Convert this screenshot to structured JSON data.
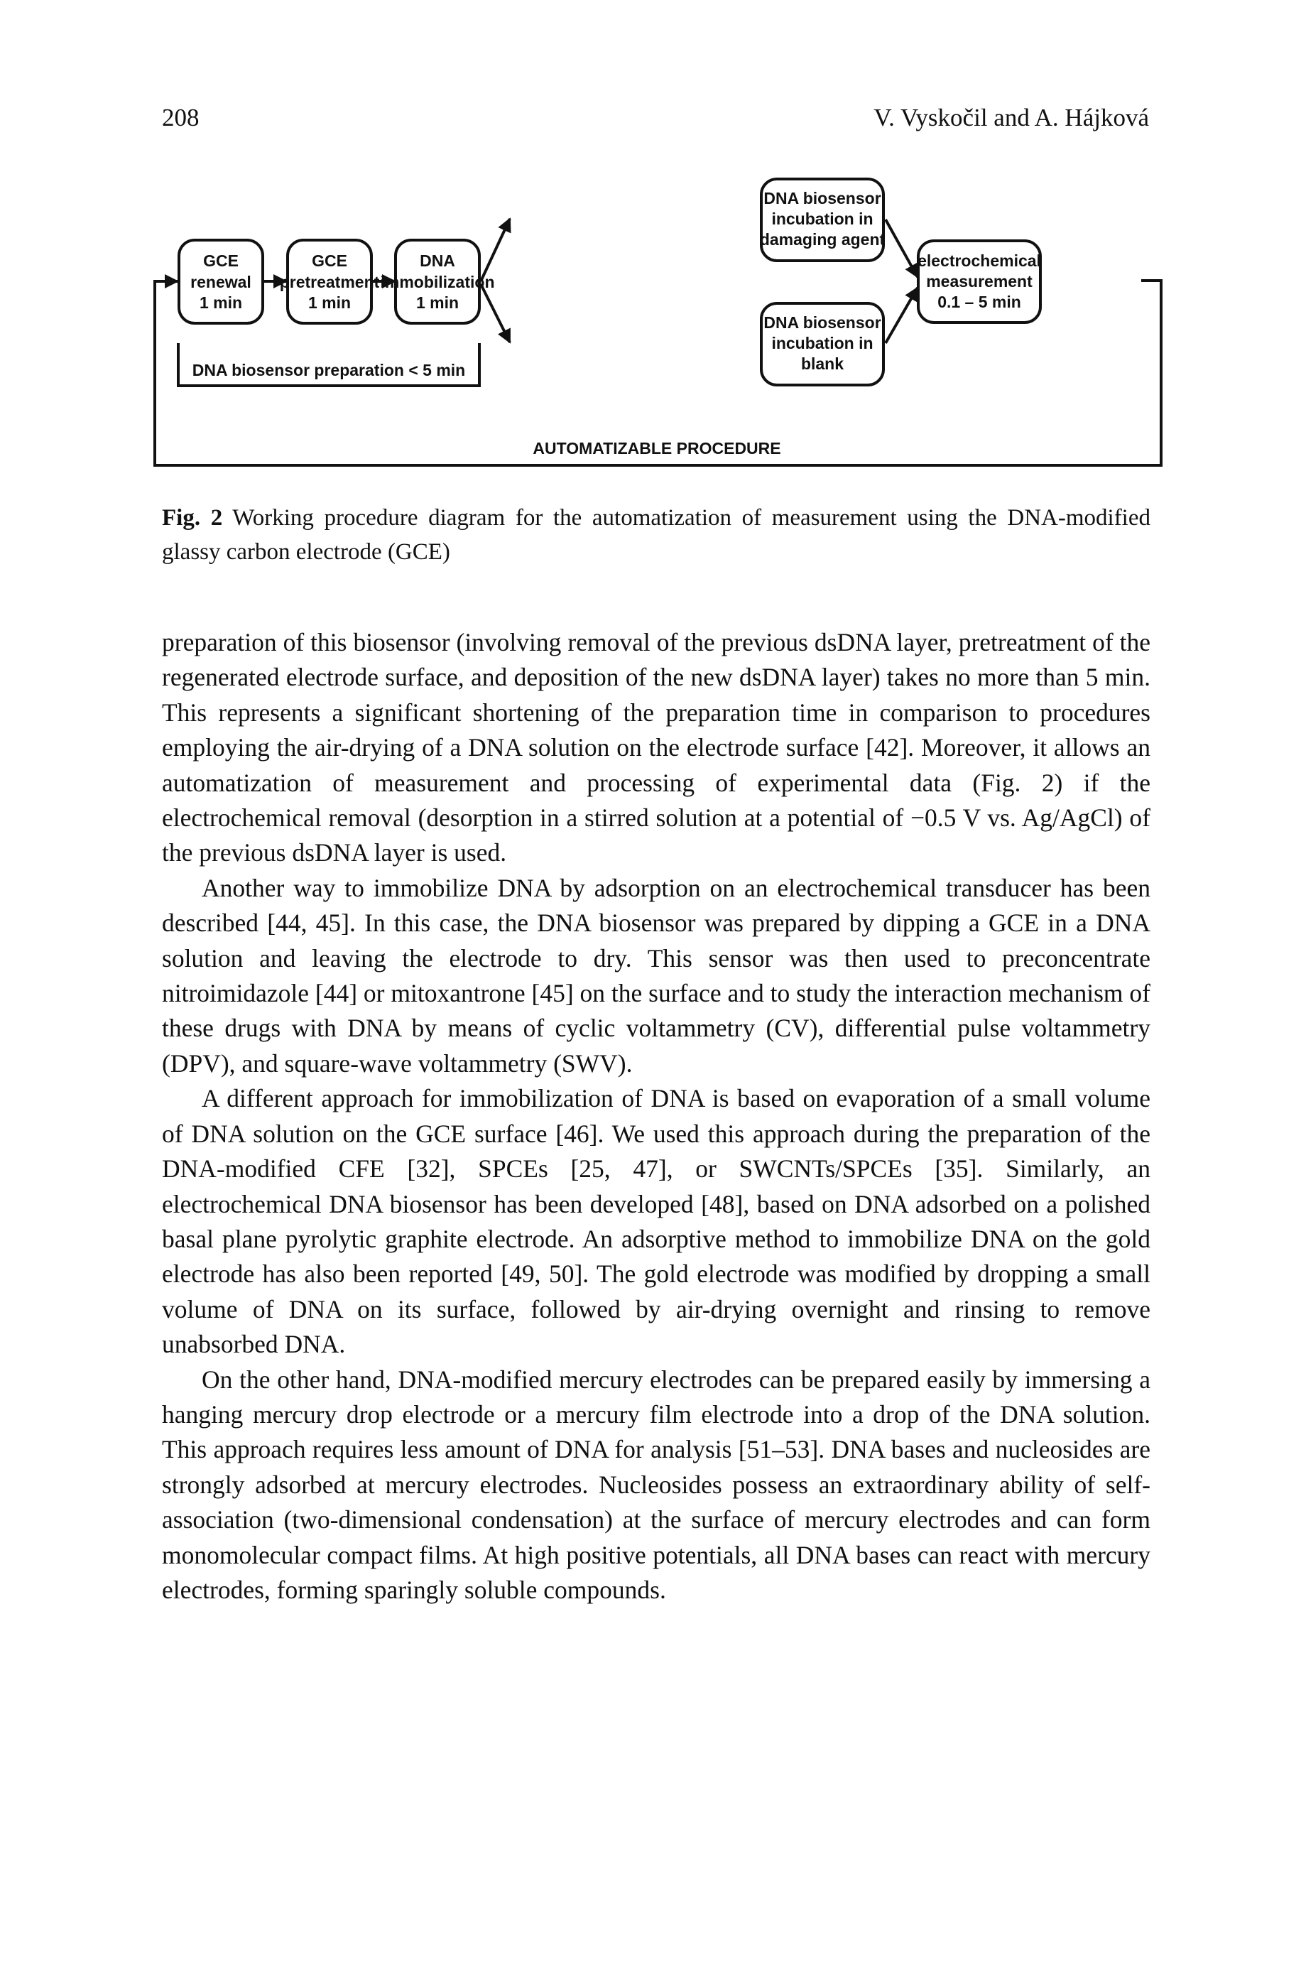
{
  "header": {
    "page_number": "208",
    "running_head": "V. Vyskočil and A. Hájková"
  },
  "figure": {
    "boxes": {
      "gce_renewal": [
        "GCE",
        "renewal",
        "1 min"
      ],
      "gce_pretreatment": [
        "GCE",
        "pretreatment",
        "1 min"
      ],
      "dna_immobilization": [
        "DNA",
        "immobilization",
        "1 min"
      ],
      "incubation_damaging": [
        "DNA biosensor",
        "incubation in",
        "damaging agent"
      ],
      "incubation_blank": [
        "DNA biosensor",
        "incubation in",
        "blank"
      ],
      "electrochemical_measurement": [
        "electrochemical",
        "measurement",
        "0.1 – 5 min"
      ]
    },
    "preparation_label": "DNA biosensor preparation < 5 min",
    "procedure_label": "AUTOMATIZABLE PROCEDURE"
  },
  "caption": {
    "label": "Fig. 2",
    "text": " Working procedure diagram for the automatization of measurement using the DNA-modified glassy carbon electrode (GCE)"
  },
  "paragraphs": [
    "preparation of this biosensor (involving removal of the previous dsDNA layer, pretreatment of the regenerated electrode surface, and deposition of the new dsDNA layer) takes no more than 5 min. This represents a significant shortening of the preparation time in comparison to procedures employing the air-drying of a DNA solution on the electrode surface [42]. Moreover, it allows an automatization of measurement and processing of experimental data (Fig. 2) if the electrochemical removal (desorption in a stirred solution at a potential of −0.5 V vs. Ag/AgCl) of the previous dsDNA layer is used.",
    "Another way to immobilize DNA by adsorption on an electrochemical transducer has been described [44, 45]. In this case, the DNA biosensor was prepared by dipping a GCE in a DNA solution and leaving the electrode to dry. This sensor was then used to preconcentrate nitroimidazole [44] or mitoxantrone [45] on the surface and to study the interaction mechanism of these drugs with DNA by means of cyclic voltammetry (CV), differential pulse voltammetry (DPV), and square-wave voltammetry (SWV).",
    "A different approach for immobilization of DNA is based on evaporation of a small volume of DNA solution on the GCE surface [46]. We used this approach during the preparation of the DNA-modified CFE [32], SPCEs [25, 47], or SWCNTs/SPCEs [35]. Similarly, an electrochemical DNA biosensor has been developed [48], based on DNA adsorbed on a polished basal plane pyrolytic graphite electrode. An adsorptive method to immobilize DNA on the gold electrode has also been reported [49, 50]. The gold electrode was modified by dropping a small volume of DNA on its surface, followed by air-drying overnight and rinsing to remove unabsorbed DNA.",
    "On the other hand, DNA-modified mercury electrodes can be prepared easily by immersing a hanging mercury drop electrode or a mercury film electrode into a drop of the DNA solution. This approach requires less amount of DNA for analysis [51–53]. DNA bases and nucleosides are strongly adsorbed at mercury electrodes. Nucleosides possess an extraordinary ability of self-association (two-dimensional condensation) at the surface of mercury electrodes and can form monomolecular compact films. At high positive potentials, all DNA bases can react with mercury electrodes, forming sparingly soluble compounds."
  ]
}
